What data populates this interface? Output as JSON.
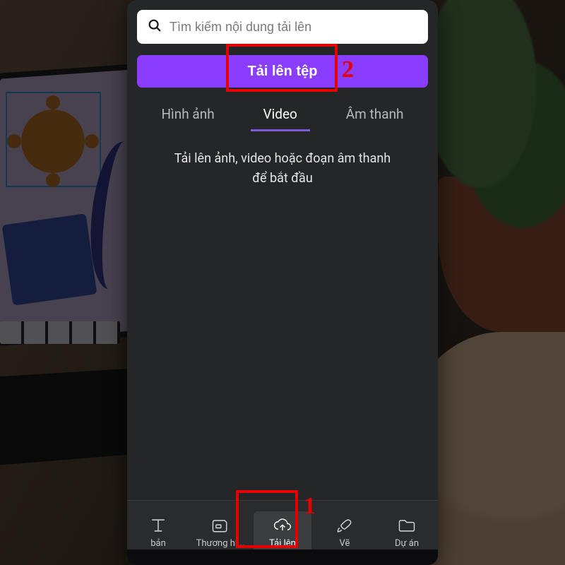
{
  "search": {
    "placeholder": "Tìm kiếm nội dung tải lên"
  },
  "upload_button": {
    "label": "Tải lên tệp"
  },
  "tabs": {
    "images": "Hình ảnh",
    "video": "Video",
    "audio": "Âm thanh",
    "active": "video"
  },
  "empty_state": {
    "line1": "Tải lên ảnh, video hoặc đoạn âm thanh",
    "line2": "để bắt đầu"
  },
  "bottom_nav": {
    "text": {
      "label": "bản"
    },
    "brand": {
      "label": "Thương hi..."
    },
    "upload": {
      "label": "Tải lên"
    },
    "draw": {
      "label": "Vẽ"
    },
    "projects": {
      "label": "Dự án"
    },
    "active": "upload"
  },
  "annotations": {
    "n1": "1",
    "n2": "2"
  }
}
